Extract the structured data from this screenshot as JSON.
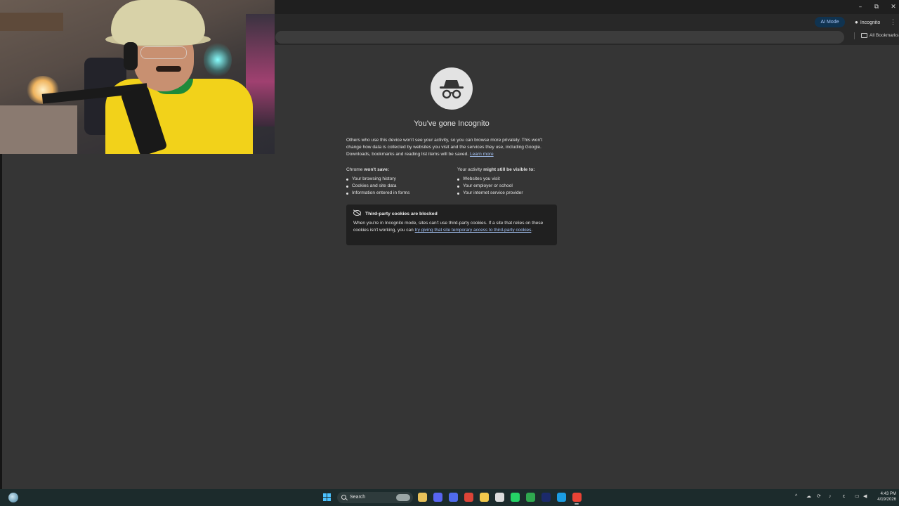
{
  "browser": {
    "window_controls": {
      "minimize": "–",
      "restore": "⧉",
      "close": "✕"
    },
    "ai_mode_label": "AI Mode",
    "incognito_label": "Incognito",
    "all_bookmarks_label": "All Bookmarks",
    "menu_glyph": "⋮"
  },
  "incognito_page": {
    "title": "You've gone Incognito",
    "description": "Others who use this device won't see your activity, so you can browse more privately. This won't change how data is collected by websites you visit and the services they use, including Google. Downloads, bookmarks and reading list items will be saved.",
    "learn_more": "Learn more",
    "wont_save": {
      "heading_prefix": "Chrome ",
      "heading_bold": "won't save:",
      "items": [
        "Your browsing history",
        "Cookies and site data",
        "Information entered in forms"
      ]
    },
    "might_be_visible": {
      "heading_prefix": "Your activity ",
      "heading_bold": "might still be visible to:",
      "items": [
        "Websites you visit",
        "Your employer or school",
        "Your internet service provider"
      ]
    },
    "cookies_box": {
      "title": "Third-party cookies are blocked",
      "text": "When you're in Incognito mode, sites can't use third-party cookies. If a site that relies on these cookies isn't working, you can ",
      "link": "try giving that site temporary access to third-party cookies",
      "end": "."
    }
  },
  "taskbar": {
    "search_label": "Search",
    "tray_chevron": "^",
    "clock_time": "4:43 PM",
    "clock_date": "4/19/2026",
    "apps": [
      {
        "name": "file-explorer-icon",
        "color": "#e8c25a"
      },
      {
        "name": "discord-icon",
        "color": "#5865f2"
      },
      {
        "name": "chat-icon",
        "color": "#4f6bed"
      },
      {
        "name": "chrome-icon",
        "color": "#db4437"
      },
      {
        "name": "folder-icon",
        "color": "#f2c94c"
      },
      {
        "name": "calendar-icon",
        "color": "#dcdcdc"
      },
      {
        "name": "whatsapp-icon",
        "color": "#25d366"
      },
      {
        "name": "download-manager-icon",
        "color": "#2fa84f"
      },
      {
        "name": "terminal-icon",
        "color": "#1b2a6b"
      },
      {
        "name": "edge-icon",
        "color": "#1b9de2"
      },
      {
        "name": "chrome-incognito-icon",
        "color": "#ea4335"
      }
    ]
  }
}
